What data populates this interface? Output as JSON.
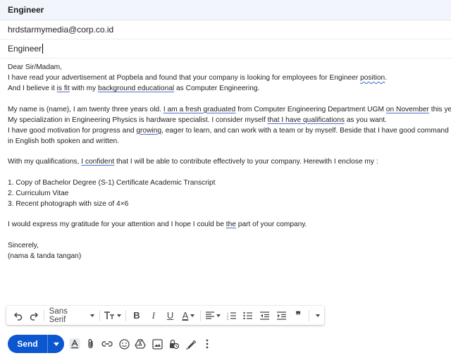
{
  "window": {
    "title": "Engineer"
  },
  "compose": {
    "to": "hrdstarmymedia@corp.co.id",
    "subject": "Engineer"
  },
  "body": {
    "l1": "Dear Sir/Madam,",
    "l2a": "I have read your advertisement at Popbela and found that your company is looking for employees for Engineer ",
    "l2b": "position",
    "l2c": ".",
    "l3a": "And I believe it ",
    "l3b": "is fit",
    "l3c": " with my ",
    "l3d": "background educational",
    "l3e": " as Computer Engineering.",
    "l4a": "My name is (name), I am twenty three years old. ",
    "l4b": "I am a fresh graduated",
    "l4c": " from Computer Engineering Department UGM ",
    "l4d": "on November",
    "l4e": " this year.",
    "l5a": "My specialization in Engineering Physics is hardware specialist. I consider myself ",
    "l5b": "that I have qualifications",
    "l5c": " as you want.",
    "l6a": "I have good motivation for progress and ",
    "l6b": "growing",
    "l6c": ", eager to learn, and can work with a team or by myself. Beside that I have good command",
    "l7": " in English both spoken and written.",
    "l8a": "With my qualifications, ",
    "l8b": "I confident",
    "l8c": " that I will be able to contribute effectively to your company. Herewith I enclose my :",
    "l9": "1. Copy of Bachelor Degree (S-1) Certificate Academic Transcript",
    "l10": "2. Curriculum Vitae",
    "l11": "3. Recent photograph with size of 4×6",
    "l12a": "I would express my gratitude for your attention and I hope I could be ",
    "l12b": "the",
    "l12c": " part of your company.",
    "l13": "Sincerely,",
    "l14": "(nama & tanda tangan)"
  },
  "toolbar": {
    "font": "Sans Serif",
    "bold": "B",
    "italic": "I",
    "underline": "U",
    "text_color": "A",
    "quote": "❞"
  },
  "send": {
    "label": "Send"
  },
  "colors": {
    "send_bg": "#0b57d0",
    "header_bg": "#f2f6fc",
    "underline": "#4a6fd6"
  }
}
